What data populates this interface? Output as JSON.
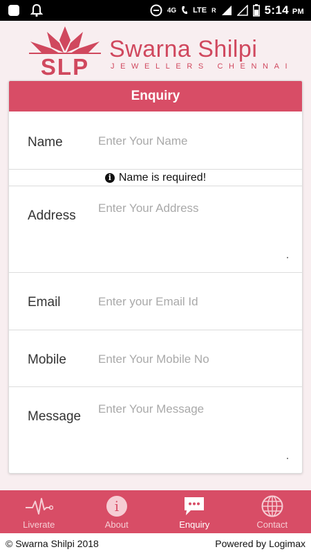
{
  "status_bar": {
    "time": "5:14",
    "ampm": "PM",
    "network": "4G",
    "lte": "LTE",
    "roaming": "R"
  },
  "brand": {
    "mark": "SLP",
    "name": "Swarna Shilpi",
    "tagline": "JEWELLERS CHENNAI",
    "color": "#d0485e"
  },
  "form": {
    "title": "Enquiry",
    "accent": "#d84d66",
    "fields": {
      "name": {
        "label": "Name",
        "placeholder": "Enter Your Name",
        "value": ""
      },
      "address": {
        "label": "Address",
        "placeholder": "Enter Your Address",
        "value": ""
      },
      "email": {
        "label": "Email",
        "placeholder": "Enter your Email Id",
        "value": ""
      },
      "mobile": {
        "label": "Mobile",
        "placeholder": "Enter Your Mobile No",
        "value": ""
      },
      "message": {
        "label": "Message",
        "placeholder": "Enter Your Message",
        "value": ""
      }
    },
    "error": {
      "icon": "info-icon",
      "text": "Name is required!"
    }
  },
  "bottom_nav": {
    "items": [
      {
        "label": "Liverate",
        "icon": "heartbeat-icon"
      },
      {
        "label": "About",
        "icon": "info-circle-icon"
      },
      {
        "label": "Enquiry",
        "icon": "chat-bubble-icon",
        "active": true
      },
      {
        "label": "Contact",
        "icon": "globe-icon"
      }
    ]
  },
  "footer": {
    "copyright": "© Swarna Shilpi 2018",
    "powered": "Powered by Logimax"
  }
}
